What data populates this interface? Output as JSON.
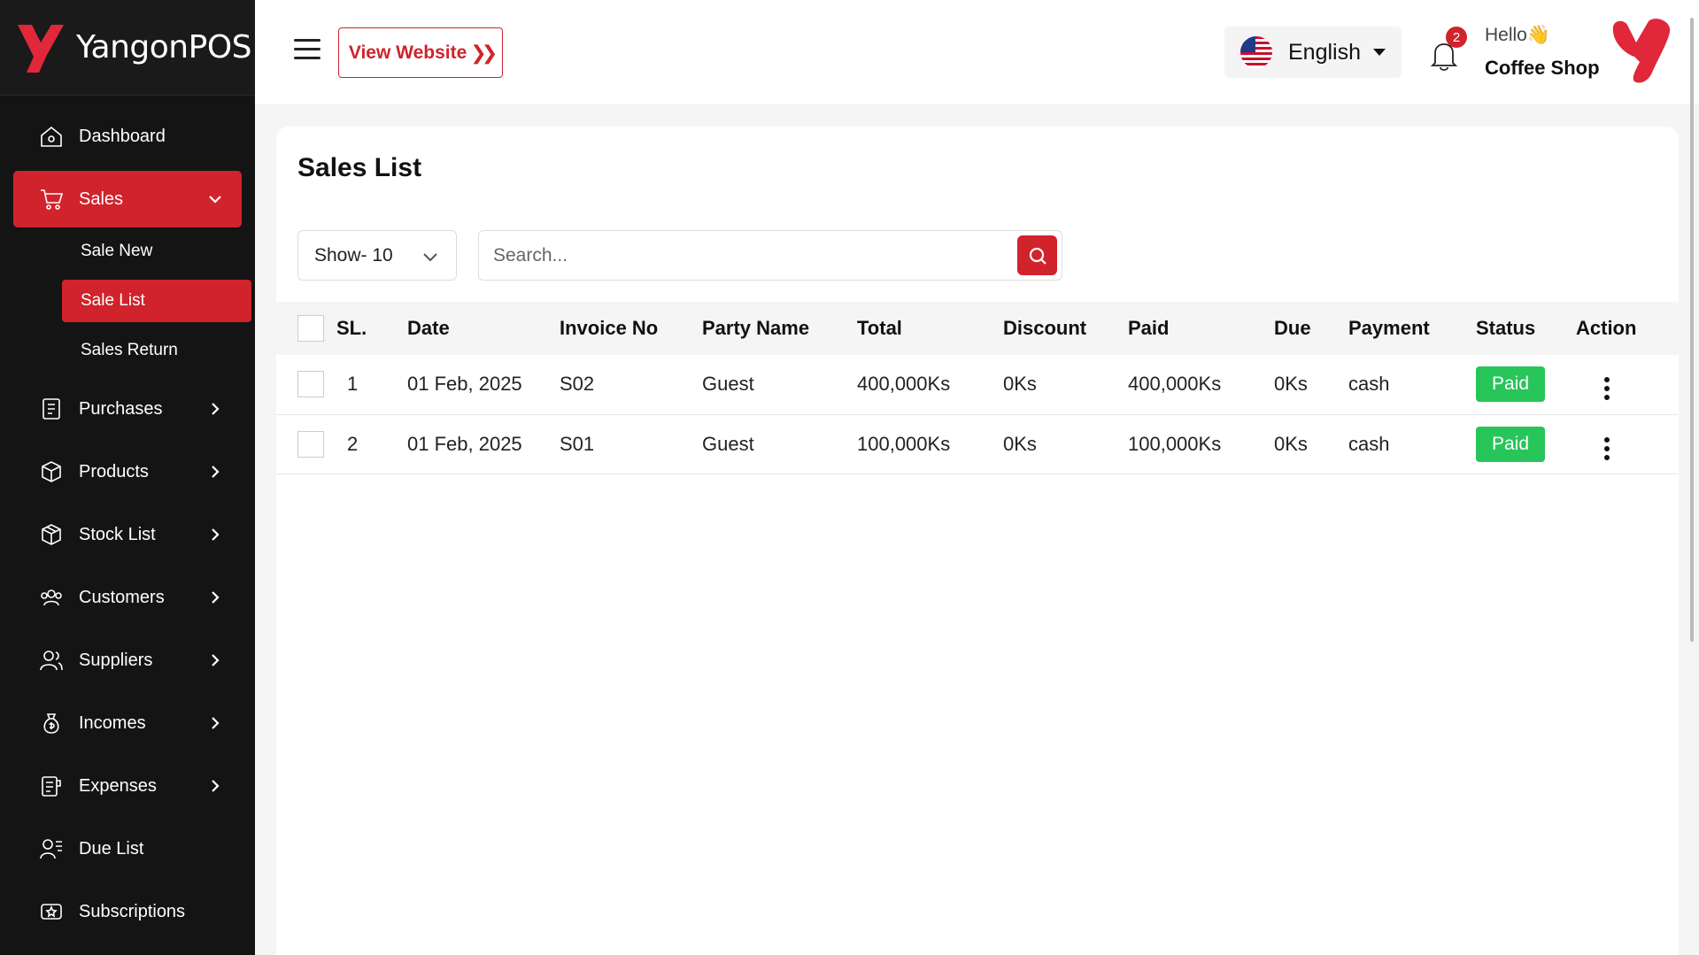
{
  "brand": {
    "name": "YangonPOS"
  },
  "sidebar": {
    "items": [
      {
        "label": "Dashboard",
        "icon": "home-icon"
      },
      {
        "label": "Sales",
        "icon": "cart-icon"
      },
      {
        "label": "Purchases",
        "icon": "receipt-icon"
      },
      {
        "label": "Products",
        "icon": "box-icon"
      },
      {
        "label": "Stock List",
        "icon": "cube-icon"
      },
      {
        "label": "Customers",
        "icon": "users-icon"
      },
      {
        "label": "Suppliers",
        "icon": "suppliers-icon"
      },
      {
        "label": "Incomes",
        "icon": "money-bag-icon"
      },
      {
        "label": "Expenses",
        "icon": "expense-icon"
      },
      {
        "label": "Due List",
        "icon": "due-list-icon"
      },
      {
        "label": "Subscriptions",
        "icon": "subscription-icon"
      }
    ],
    "sales_sub": [
      {
        "label": "Sale New"
      },
      {
        "label": "Sale List"
      },
      {
        "label": "Sales Return"
      }
    ]
  },
  "topbar": {
    "view_website": "View Website",
    "language": "English",
    "notification_count": "2",
    "greeting": "Hello👋",
    "user_name": "Coffee Shop"
  },
  "colors": {
    "accent": "#d0232b",
    "paid": "#28c55a",
    "sidebar_bg": "#141414"
  },
  "main": {
    "title": "Sales List",
    "show_select": "Show- 10",
    "search": {
      "placeholder": "Search..."
    },
    "table": {
      "headers": [
        "SL.",
        "Date",
        "Invoice No",
        "Party Name",
        "Total",
        "Discount",
        "Paid",
        "Due",
        "Payment",
        "Status",
        "Action"
      ],
      "rows": [
        {
          "sl": "1",
          "date": "01 Feb, 2025",
          "invoice": "S02",
          "party": "Guest",
          "total": "400,000Ks",
          "discount": "0Ks",
          "paid": "400,000Ks",
          "due": "0Ks",
          "payment": "cash",
          "status": "Paid"
        },
        {
          "sl": "2",
          "date": "01 Feb, 2025",
          "invoice": "S01",
          "party": "Guest",
          "total": "100,000Ks",
          "discount": "0Ks",
          "paid": "100,000Ks",
          "due": "0Ks",
          "payment": "cash",
          "status": "Paid"
        }
      ]
    }
  }
}
